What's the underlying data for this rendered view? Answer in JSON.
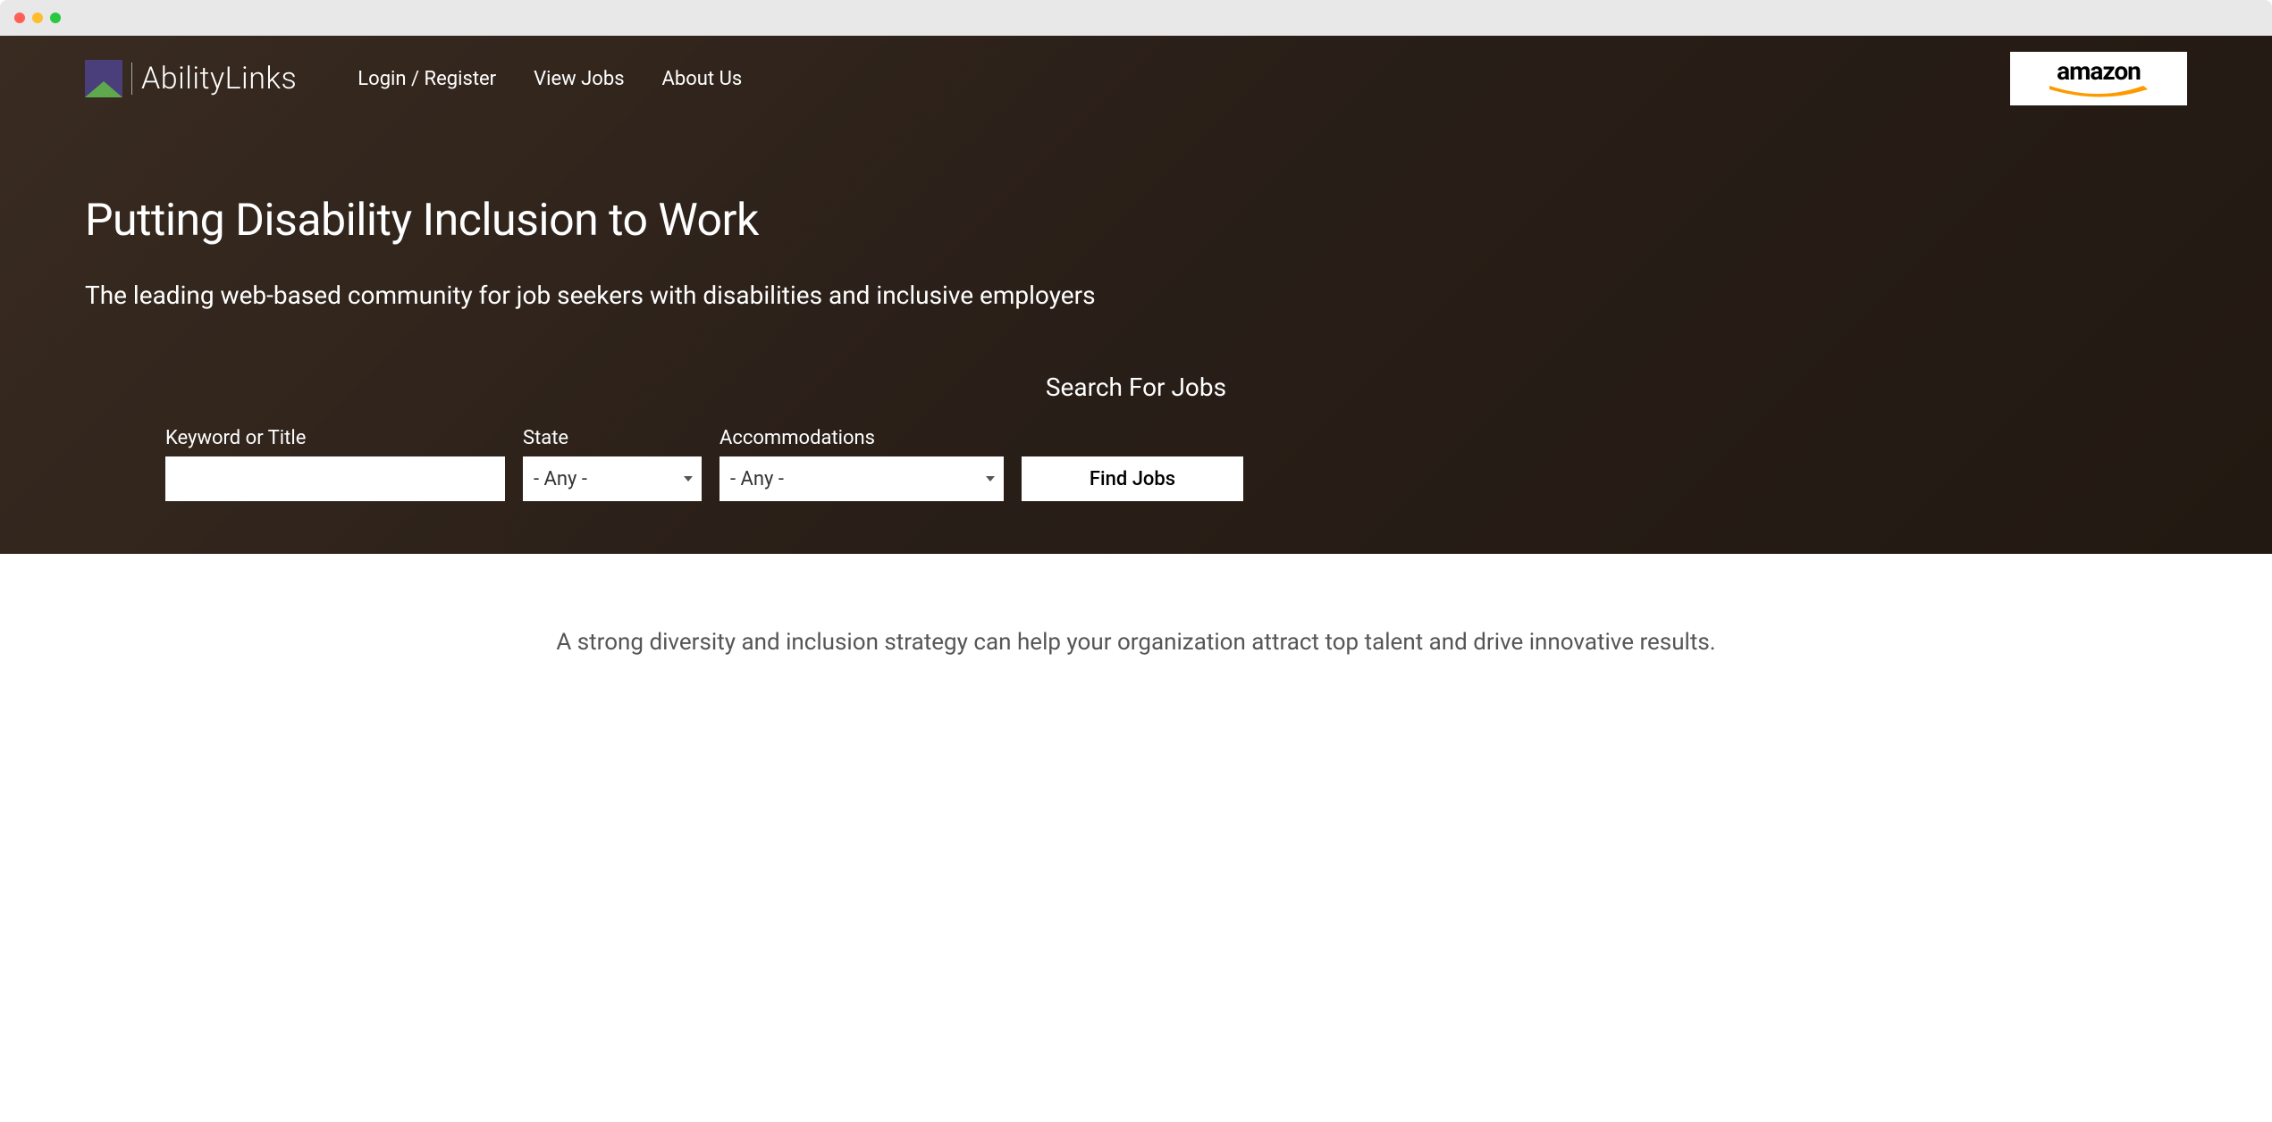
{
  "logo": {
    "text": "AbilityLinks"
  },
  "nav": {
    "login": "Login / Register",
    "viewJobs": "View Jobs",
    "aboutUs": "About Us"
  },
  "sponsor": {
    "name": "amazon"
  },
  "hero": {
    "title": "Putting Disability Inclusion to Work",
    "subtitle": "The leading web-based community for job seekers with disabilities and inclusive employers"
  },
  "search": {
    "heading": "Search For Jobs",
    "keywordLabel": "Keyword or Title",
    "keywordValue": "",
    "stateLabel": "State",
    "stateValue": "- Any -",
    "accommodationsLabel": "Accommodations",
    "accommodationsValue": "- Any -",
    "buttonLabel": "Find Jobs"
  },
  "below": {
    "text": "A strong diversity and inclusion strategy can help your organization attract top talent and drive innovative results."
  }
}
